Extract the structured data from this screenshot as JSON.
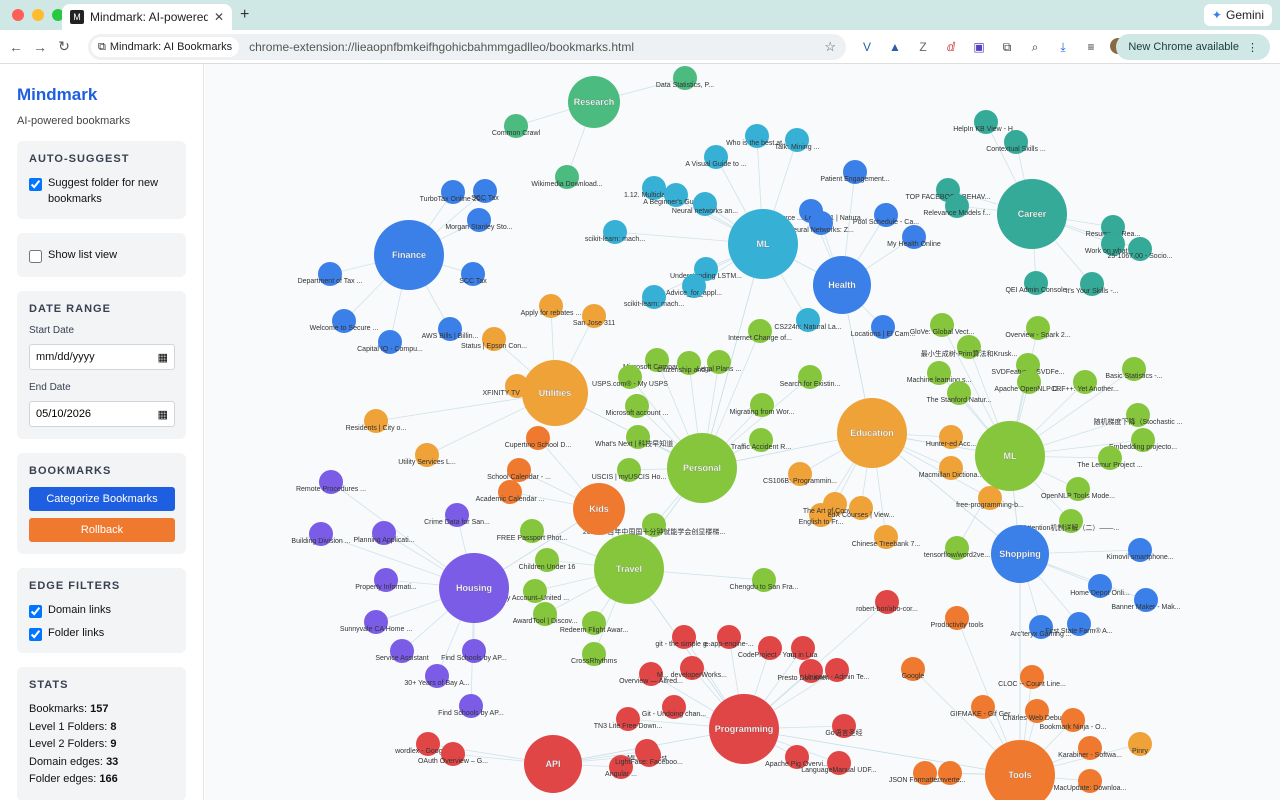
{
  "browser": {
    "tab_title": "Mindmark: AI-powered Bookm…",
    "gemini_label": "Gemini",
    "chip_label": "Mindmark: AI Bookmarks",
    "url": "chrome-extension://lieaopnfbmkeifhgohicbahmmgadlleo/bookmarks.html",
    "update_label": "New Chrome available"
  },
  "sidebar": {
    "title": "Mindmark",
    "tagline": "AI-powered bookmarks",
    "auto_suggest": {
      "heading": "AUTO-SUGGEST",
      "label": "Suggest folder for new bookmarks",
      "checked": true
    },
    "list_view": {
      "label": "Show list view",
      "checked": false
    },
    "date_range": {
      "heading": "DATE RANGE",
      "start_label": "Start Date",
      "start_value": "mm/dd/yyyy",
      "end_label": "End Date",
      "end_value": "05/10/2026"
    },
    "bookmarks": {
      "heading": "BOOKMARKS",
      "categorize_label": "Categorize Bookmarks",
      "rollback_label": "Rollback"
    },
    "edge_filters": {
      "heading": "EDGE FILTERS",
      "domain_label": "Domain links",
      "folder_label": "Folder links"
    },
    "stats": {
      "heading": "STATS",
      "items": [
        {
          "label": "Bookmarks:",
          "value": "157"
        },
        {
          "label": "Level 1 Folders:",
          "value": "8"
        },
        {
          "label": "Level 2 Folders:",
          "value": "9"
        },
        {
          "label": "Domain edges:",
          "value": "33"
        },
        {
          "label": "Folder edges:",
          "value": "166"
        }
      ]
    }
  },
  "colors": {
    "green": "#4cbb7f",
    "teal": "#35aa98",
    "blue": "#3b7fe8",
    "cyan": "#37b0d6",
    "orange": "#eea238",
    "lime": "#86c63d",
    "red": "#e04646",
    "purple": "#7a5ce6",
    "deeporange": "#ef7a2f",
    "accent": "#1d5fe0"
  },
  "graph": {
    "hubs": [
      {
        "label": "Research",
        "color": "green"
      },
      {
        "label": "Finance",
        "color": "blue"
      },
      {
        "label": "ML",
        "color": "cyan"
      },
      {
        "label": "Health",
        "color": "blue"
      },
      {
        "label": "Career",
        "color": "teal"
      },
      {
        "label": "Utilities",
        "color": "orange"
      },
      {
        "label": "Education",
        "color": "orange"
      },
      {
        "label": "ML",
        "color": "lime"
      },
      {
        "label": "Personal",
        "color": "lime"
      },
      {
        "label": "Kids",
        "color": "deeporange"
      },
      {
        "label": "Travel",
        "color": "lime"
      },
      {
        "label": "Shopping",
        "color": "blue"
      },
      {
        "label": "Housing",
        "color": "purple"
      },
      {
        "label": "Programming",
        "color": "red"
      },
      {
        "label": "API",
        "color": "red"
      },
      {
        "label": "Tools",
        "color": "deeporange"
      }
    ],
    "nodes": [
      {
        "label": "Data Statistics, P...",
        "hub": 0,
        "color": "green"
      },
      {
        "label": "Common Crawl",
        "hub": 0,
        "color": "green"
      },
      {
        "label": "Wikimedia Download...",
        "hub": 0,
        "color": "green"
      },
      {
        "label": "SCC Tax",
        "hub": 1,
        "color": "blue"
      },
      {
        "label": "TurboTax Online 20...",
        "hub": 1,
        "color": "blue"
      },
      {
        "label": "Morgan Stanley Sto...",
        "hub": 1,
        "color": "blue"
      },
      {
        "label": "Department of Tax ...",
        "hub": 1,
        "color": "blue"
      },
      {
        "label": "SCC Tax",
        "hub": 1,
        "color": "blue"
      },
      {
        "label": "Welcome to Secure ...",
        "hub": 1,
        "color": "blue"
      },
      {
        "label": "AWS Bills | Billin...",
        "hub": 1,
        "color": "blue"
      },
      {
        "label": "Capital IQ - Compu...",
        "hub": 1,
        "color": "blue"
      },
      {
        "label": "Who is the best at...",
        "hub": 2,
        "color": "cyan"
      },
      {
        "label": "Talk: Mining ...",
        "hub": 2,
        "color": "cyan"
      },
      {
        "label": "A Visual Guide to ...",
        "hub": 2,
        "color": "cyan"
      },
      {
        "label": "1.12. Multiclass a...",
        "hub": 2,
        "color": "cyan"
      },
      {
        "label": "A Beginner's Guide...",
        "hub": 2,
        "color": "cyan"
      },
      {
        "label": "Neural networks an...",
        "hub": 2,
        "color": "cyan"
      },
      {
        "label": "scikit-learn: mach...",
        "hub": 2,
        "color": "cyan"
      },
      {
        "label": "Understanding LSTM...",
        "hub": 2,
        "color": "cyan"
      },
      {
        "label": "Advice_for_appl...",
        "hub": 2,
        "color": "cyan"
      },
      {
        "label": "scikit-learn: mach...",
        "hub": 2,
        "color": "cyan"
      },
      {
        "label": "CS224n: Natural La...",
        "hub": 2,
        "color": "cyan"
      },
      {
        "label": "Patient Engagement...",
        "hub": 3,
        "color": "blue"
      },
      {
        "label": "29 Resource ... Lecture 1 | Natura...",
        "hub": 3,
        "color": "blue"
      },
      {
        "label": "Neural Networks: Z...",
        "hub": 3,
        "color": "blue"
      },
      {
        "label": "Pool Schedule - Ca...",
        "hub": 3,
        "color": "blue"
      },
      {
        "label": "My Health Online",
        "hub": 3,
        "color": "blue"
      },
      {
        "label": "Locations | El Cam...",
        "hub": 3,
        "color": "blue"
      },
      {
        "label": "HelpIn KB View - H...",
        "hub": 4,
        "color": "teal"
      },
      {
        "label": "Contextual Skills ...",
        "hub": 4,
        "color": "teal"
      },
      {
        "label": "TOP FACEBOOK BEHAV...",
        "hub": 4,
        "color": "teal"
      },
      {
        "label": "Relevance Models f...",
        "hub": 4,
        "color": "teal"
      },
      {
        "label": "Resumes - Rea...",
        "hub": 4,
        "color": "teal"
      },
      {
        "label": "Work on what m...",
        "hub": 4,
        "color": "teal"
      },
      {
        "label": "25-1067.00 - Socio...",
        "hub": 4,
        "color": "teal"
      },
      {
        "label": "QEI Admin Console",
        "hub": 4,
        "color": "teal"
      },
      {
        "label": "It's Your Skills -...",
        "hub": 4,
        "color": "teal"
      },
      {
        "label": "Apply for rebates ...",
        "hub": 5,
        "color": "orange"
      },
      {
        "label": "San Jose 311",
        "hub": 5,
        "color": "orange"
      },
      {
        "label": "Status | Epson Con...",
        "hub": 5,
        "color": "orange"
      },
      {
        "label": "XFINITY TV Local C...",
        "hub": 5,
        "color": "orange"
      },
      {
        "label": "Residents | City o...",
        "hub": 5,
        "color": "orange"
      },
      {
        "label": "Utility Services L...",
        "hub": 5,
        "color": "orange"
      },
      {
        "label": "Internet Change of...",
        "hub": 8,
        "color": "lime"
      },
      {
        "label": "Microsoft Company ...",
        "hub": 8,
        "color": "lime"
      },
      {
        "label": "USPS.com® - My USPS",
        "hub": 8,
        "color": "lime"
      },
      {
        "label": "Citizenship and Im...",
        "hub": 8,
        "color": "lime"
      },
      {
        "label": "Legal Plans ...",
        "hub": 8,
        "color": "lime"
      },
      {
        "label": "Search for Existin...",
        "hub": 8,
        "color": "lime"
      },
      {
        "label": "Microsoft account ...",
        "hub": 8,
        "color": "lime"
      },
      {
        "label": "Migrating from Wor...",
        "hub": 8,
        "color": "lime"
      },
      {
        "label": "What's Next | 科技早知道 ...",
        "hub": 8,
        "color": "lime"
      },
      {
        "label": "Traffic Accident R...",
        "hub": 8,
        "color": "lime"
      },
      {
        "label": "USCIS | myUSCIS Ho...",
        "hub": 8,
        "color": "lime"
      },
      {
        "label": "Cupertino School D...",
        "hub": 9,
        "color": "deeporange"
      },
      {
        "label": "School Calendar - ...",
        "hub": 9,
        "color": "deeporange"
      },
      {
        "label": "Academic Calendar ...",
        "hub": 9,
        "color": "deeporange"
      },
      {
        "label": "2024年 百年中国国十分钟就能学会创显楼梯...",
        "hub": 8,
        "color": "lime"
      },
      {
        "label": "Crime Data for San...",
        "hub": 12,
        "color": "purple"
      },
      {
        "label": "Remote Procedures ...",
        "hub": 12,
        "color": "purple"
      },
      {
        "label": "Building Division ...",
        "hub": 12,
        "color": "purple"
      },
      {
        "label": "Planning Applicati...",
        "hub": 12,
        "color": "purple"
      },
      {
        "label": "Property Informati...",
        "hub": 12,
        "color": "purple"
      },
      {
        "label": "Sunnyvale CA Home ...",
        "hub": 12,
        "color": "purple"
      },
      {
        "label": "Service Assistant",
        "hub": 12,
        "color": "purple"
      },
      {
        "label": "Find Schools by AP...",
        "hub": 12,
        "color": "purple"
      },
      {
        "label": "30+ Years of Bay A...",
        "hub": 12,
        "color": "purple"
      },
      {
        "label": "Find Schools by AP...",
        "hub": 12,
        "color": "purple"
      },
      {
        "label": "FREE Passport Phot...",
        "hub": 10,
        "color": "lime"
      },
      {
        "label": "Children Under 16",
        "hub": 10,
        "color": "lime"
      },
      {
        "label": "My Account–United ...",
        "hub": 10,
        "color": "lime"
      },
      {
        "label": "AwardTool | Discov...",
        "hub": 10,
        "color": "lime"
      },
      {
        "label": "Redeem Flight Awar...",
        "hub": 10,
        "color": "lime"
      },
      {
        "label": "CrossRhythms",
        "hub": 10,
        "color": "lime"
      },
      {
        "label": "Chengdu to San Fra...",
        "hub": 10,
        "color": "lime"
      },
      {
        "label": "CS106B: Programmin...",
        "hub": 6,
        "color": "orange"
      },
      {
        "label": "English to Fr...",
        "hub": 6,
        "color": "orange"
      },
      {
        "label": "The Art of Convers...",
        "hub": 6,
        "color": "orange"
      },
      {
        "label": "edX Courses | View...",
        "hub": 6,
        "color": "orange"
      },
      {
        "label": "Chinese Treebank 7...",
        "hub": 6,
        "color": "orange"
      },
      {
        "label": "Macmillan Dictiona...",
        "hub": 6,
        "color": "orange"
      },
      {
        "label": "Hunter-ed Acc...",
        "hub": 6,
        "color": "orange"
      },
      {
        "label": "free-programming-b...",
        "hub": 6,
        "color": "orange"
      },
      {
        "label": "GloVe: Global Vect...",
        "hub": 7,
        "color": "lime"
      },
      {
        "label": "Overview - Spark 2...",
        "hub": 7,
        "color": "lime"
      },
      {
        "label": "最小生成树-Prim算法和Krusk...",
        "hub": 7,
        "color": "lime"
      },
      {
        "label": "SVDFeature - SVDFe...",
        "hub": 7,
        "color": "lime"
      },
      {
        "label": "Machine learning s...",
        "hub": 7,
        "color": "lime"
      },
      {
        "label": "Basic Statistics -...",
        "hub": 7,
        "color": "lime"
      },
      {
        "label": "Apache OpenNLP D...",
        "hub": 7,
        "color": "lime"
      },
      {
        "label": "CRF++: Yet Another...",
        "hub": 7,
        "color": "lime"
      },
      {
        "label": "The Stanford Natur...",
        "hub": 7,
        "color": "lime"
      },
      {
        "label": "随机梯度下降（Stochastic ...",
        "hub": 7,
        "color": "lime"
      },
      {
        "label": "Embedding projecto...",
        "hub": 7,
        "color": "lime"
      },
      {
        "label": "The Lemur Project ...",
        "hub": 7,
        "color": "lime"
      },
      {
        "label": "OpenNLP Tools Mode...",
        "hub": 7,
        "color": "lime"
      },
      {
        "label": "Attention机制详解（二）——...",
        "hub": 7,
        "color": "lime"
      },
      {
        "label": "tensorflow/word2ve...",
        "hub": 7,
        "color": "lime"
      },
      {
        "label": "Kimovil smartphone...",
        "hub": 11,
        "color": "blue"
      },
      {
        "label": "Home Depot Onli...",
        "hub": 11,
        "color": "blue"
      },
      {
        "label": "Banner Maker - Mak...",
        "hub": 11,
        "color": "blue"
      },
      {
        "label": "Arc'teryx Gaming ...",
        "hub": 11,
        "color": "blue"
      },
      {
        "label": "First State Farm® A...",
        "hub": 11,
        "color": "blue"
      },
      {
        "label": "robert-bor/aho-cor...",
        "hub": 13,
        "color": "red"
      },
      {
        "label": "Productivity tools",
        "hub": 15,
        "color": "deeporange"
      },
      {
        "label": "git - the simple g...",
        "hub": 13,
        "color": "red"
      },
      {
        "label": "e-app-engine-...",
        "hub": 13,
        "color": "red"
      },
      {
        "label": "CodeProject - Your...",
        "hub": 13,
        "color": "red"
      },
      {
        "label": "ng in Lua",
        "hub": 13,
        "color": "red"
      },
      {
        "label": "Overview — Alfred...",
        "hub": 13,
        "color": "red"
      },
      {
        "label": "M... developerWorks...",
        "hub": 13,
        "color": "red"
      },
      {
        "label": "Presto Documentati...",
        "hub": 13,
        "color": "red"
      },
      {
        "label": "Unicorn - Admin Te...",
        "hub": 13,
        "color": "red"
      },
      {
        "label": "Git - Undoing chan...",
        "hub": 13,
        "color": "red"
      },
      {
        "label": "TN3 Lite Free Down...",
        "hub": 13,
        "color": "red"
      },
      {
        "label": "Go语言圣经",
        "hub": 13,
        "color": "red"
      },
      {
        "label": "Apache Pig Overvi...",
        "hub": 13,
        "color": "red"
      },
      {
        "label": "LanguageManual UDF...",
        "hub": 13,
        "color": "red"
      },
      {
        "label": "ML5 Contest",
        "hub": 14,
        "color": "red"
      },
      {
        "label": "Angular ...",
        "hub": 14,
        "color": "red"
      },
      {
        "label": "LightFace: Faceboo...",
        "hub": 14,
        "color": "red"
      },
      {
        "label": "wordlex - Google C...",
        "hub": 14,
        "color": "red"
      },
      {
        "label": "OAuth Overview – G...",
        "hub": 14,
        "color": "red"
      },
      {
        "label": "Google",
        "hub": 15,
        "color": "deeporange"
      },
      {
        "label": "CLOC -- Count Line...",
        "hub": 15,
        "color": "deeporange"
      },
      {
        "label": "GIFMAKE - Gif Ger...",
        "hub": 15,
        "color": "deeporange"
      },
      {
        "label": "Charles Web Debug...",
        "hub": 15,
        "color": "deeporange"
      },
      {
        "label": "Bookmark Ninja - O...",
        "hub": 15,
        "color": "deeporange"
      },
      {
        "label": "Pinry",
        "hub": 15,
        "color": "orange"
      },
      {
        "label": "Karabiner - Softwa...",
        "hub": 15,
        "color": "deeporange"
      },
      {
        "label": "JSON Formatter and ...",
        "hub": 15,
        "color": "deeporange"
      },
      {
        "label": "...nverte...",
        "hub": 15,
        "color": "deeporange"
      },
      {
        "label": "MacUpdate: Downloa...",
        "hub": 15,
        "color": "deeporange"
      }
    ]
  }
}
